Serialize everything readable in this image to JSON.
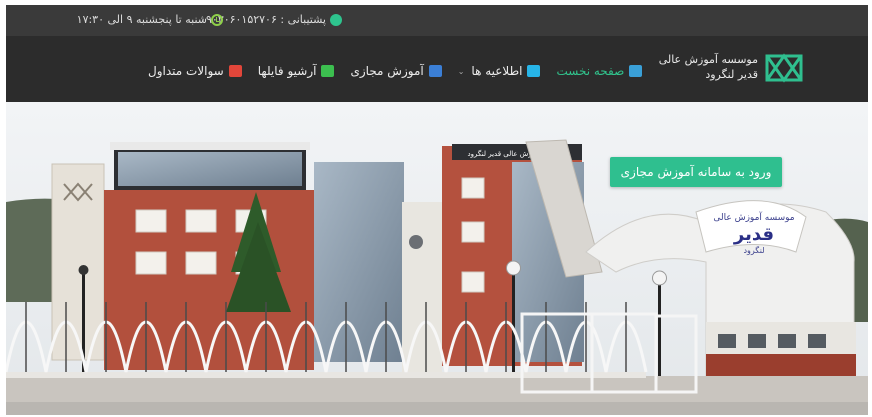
{
  "topbar": {
    "support_text": "پشتیبانی : ۰۹۰۳۰۶۰۱۵۲۷۰۶",
    "hours_text": "شنبه تا پنجشنبه ۹ الی ۱۷:۳۰",
    "support_icon": "headset-icon",
    "hours_icon": "clock-icon"
  },
  "brand": {
    "line1": "موسسه آموزش عالی",
    "line2": "قدیر لنگرود"
  },
  "nav": {
    "items": [
      {
        "label": "صفحه نخست",
        "icon": "home-icon",
        "color": "#3aa0d8",
        "active": true
      },
      {
        "label": "اطلاعیه ها",
        "icon": "news-icon",
        "color": "#27b5e8",
        "dropdown": true
      },
      {
        "label": "آموزش مجازی",
        "icon": "elearning-icon",
        "color": "#3b7fd6"
      },
      {
        "label": "آرشیو فایلها",
        "icon": "archive-icon",
        "color": "#3cbf4f"
      },
      {
        "label": "سوالات متداول",
        "icon": "faq-icon",
        "color": "#e2463a"
      }
    ]
  },
  "hero": {
    "cta_label": "ورود به سامانه آموزش مجازی",
    "gate_sign_line1": "موسسه آموزش عالی",
    "gate_sign_line2": "قدیر",
    "gate_sign_line3": "لنگرود",
    "roof_sign": "موسسه آموزش عالی قدیر لنگرود"
  },
  "colors": {
    "accent": "#2fbf8f",
    "topbar_bg": "#3a3a3a",
    "navbar_bg": "#2c2c2c"
  }
}
